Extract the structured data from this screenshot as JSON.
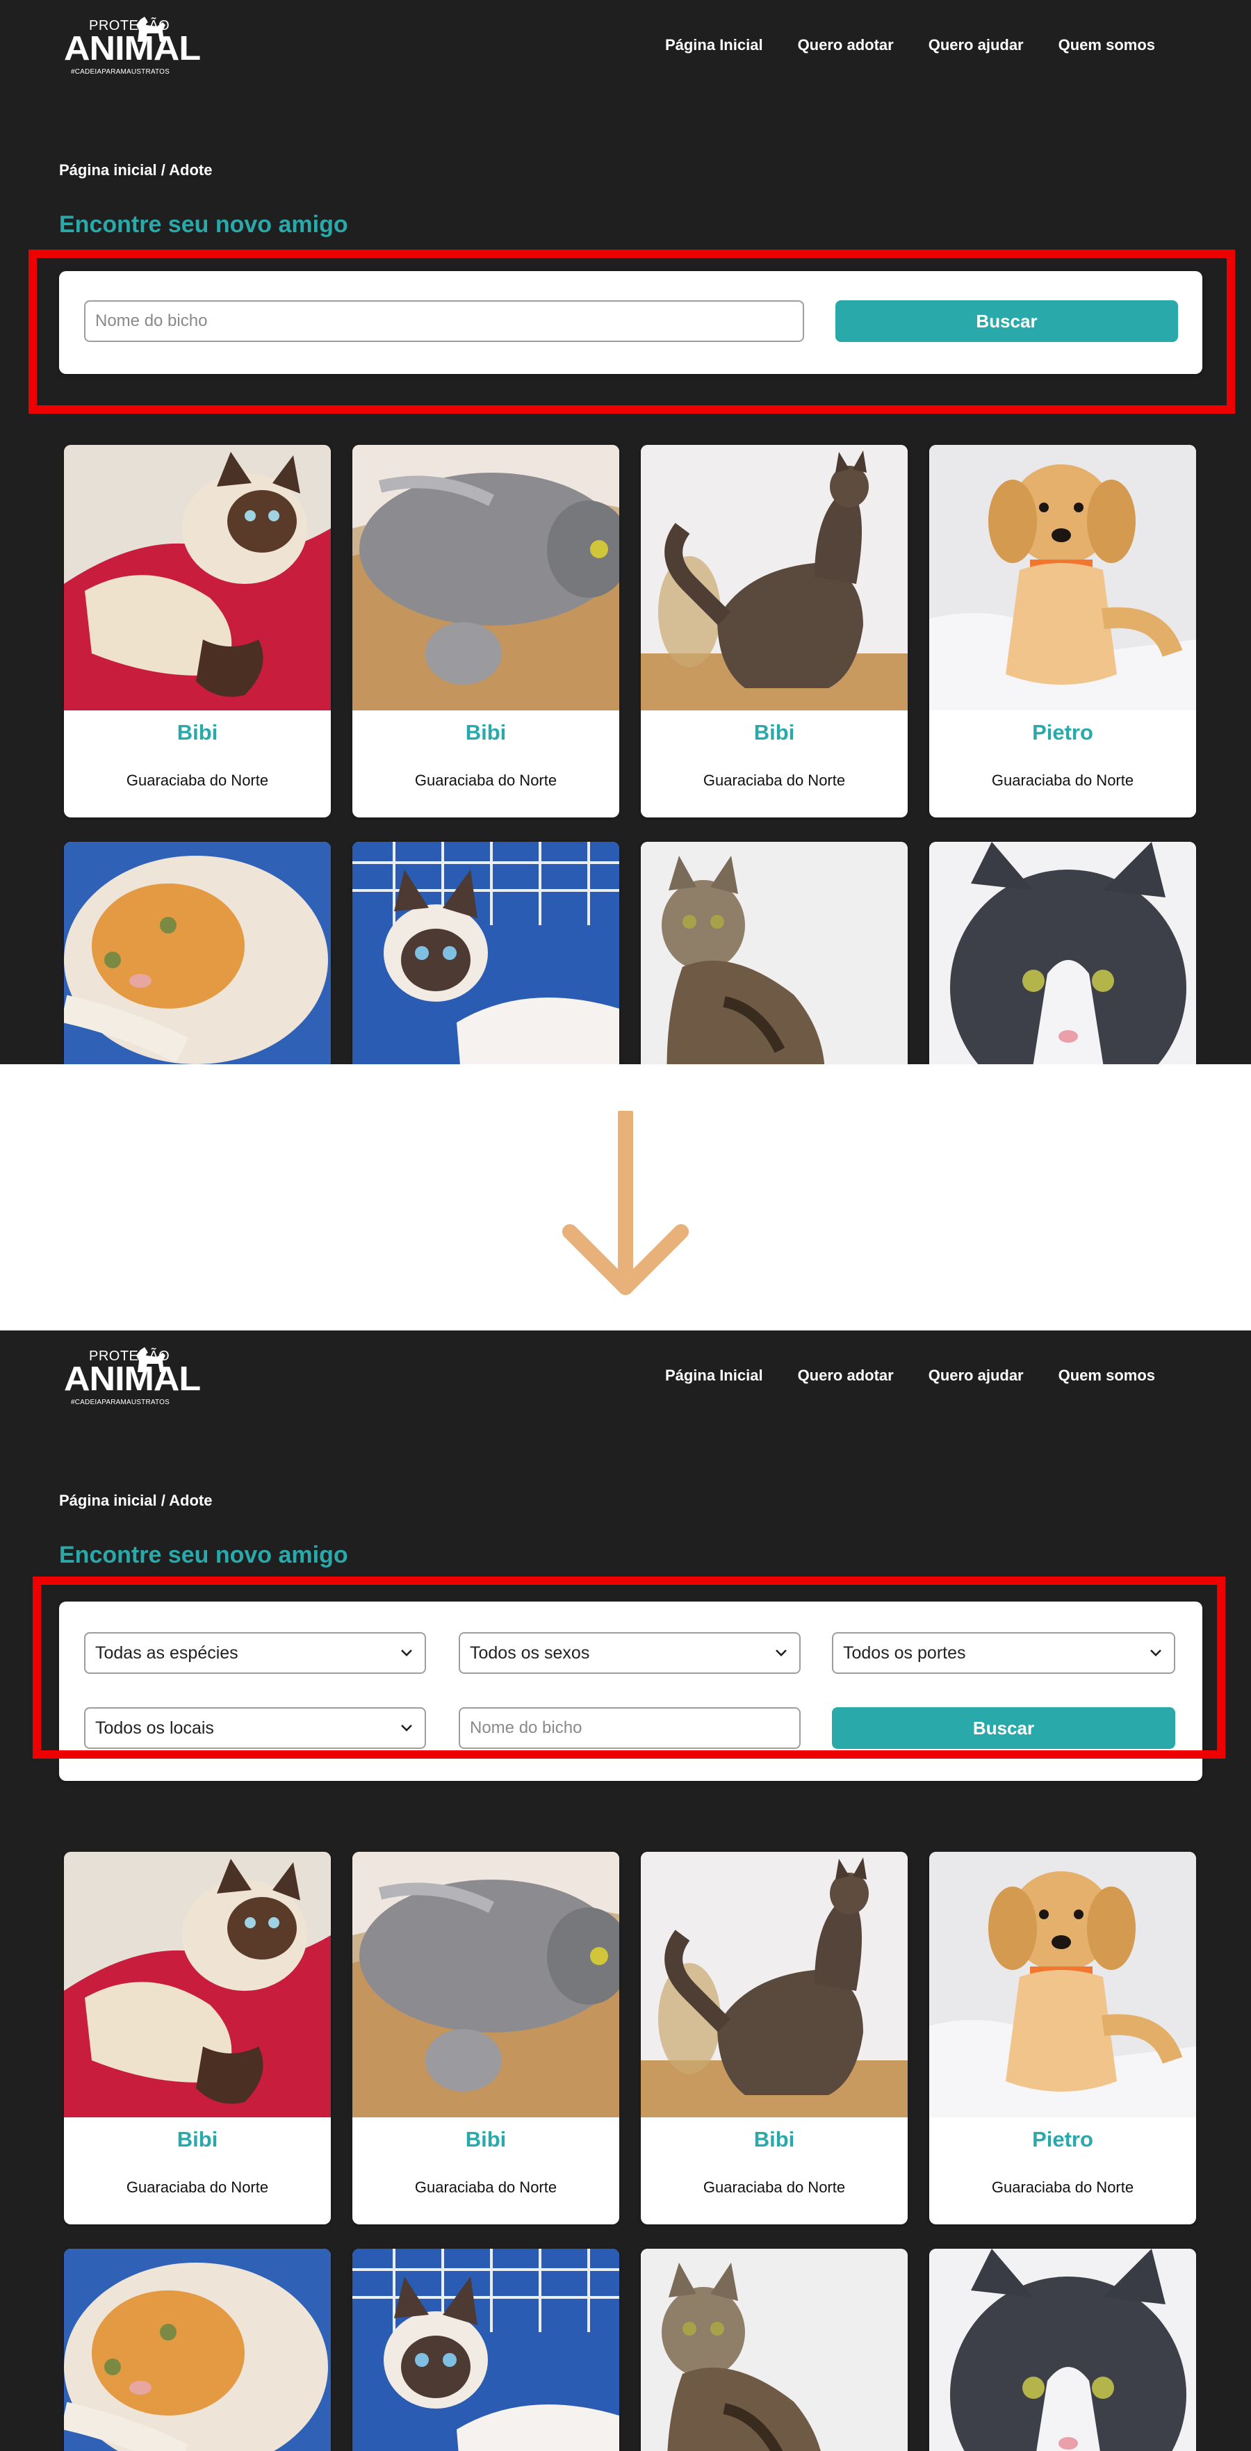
{
  "logo": {
    "line1": "PROTEÇÃO",
    "line2": "ANIMAL",
    "line3": "#CADEIAPARAMAUSTRATOS"
  },
  "nav": [
    "Página Inicial",
    "Quero adotar",
    "Quero ajudar",
    "Quem somos"
  ],
  "breadcrumb": "Página inicial / Adote",
  "heading": "Encontre seu novo amigo",
  "before_search": {
    "placeholder": "Nome do bicho",
    "button": "Buscar"
  },
  "after_search": {
    "species": "Todas as espécies",
    "sex": "Todos os sexos",
    "size": "Todos os portes",
    "location": "Todos os locais",
    "placeholder": "Nome do bicho",
    "button": "Buscar"
  },
  "animals": [
    {
      "name": "Bibi",
      "city": "Guaraciaba do Norte"
    },
    {
      "name": "Bibi",
      "city": "Guaraciaba do Norte"
    },
    {
      "name": "Bibi",
      "city": "Guaraciaba do Norte"
    },
    {
      "name": "Pietro",
      "city": "Guaraciaba do Norte"
    }
  ],
  "colors": {
    "accent": "#2aa9aa",
    "highlight": "#ee0000",
    "arrow": "#e8b17a",
    "background": "#1f1f20"
  }
}
